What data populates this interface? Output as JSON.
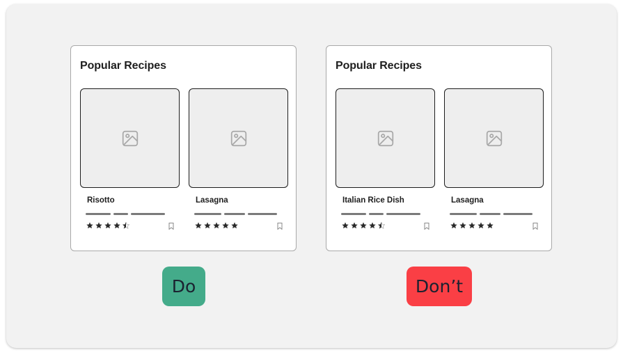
{
  "examples": [
    {
      "card_title": "Popular Recipes",
      "recipes": [
        {
          "name": "Risotto",
          "rating": 4.5,
          "image_icon": "image-placeholder-icon",
          "bookmark_icon": "bookmark-icon"
        },
        {
          "name": "Lasagna",
          "rating": 5,
          "image_icon": "image-placeholder-icon",
          "bookmark_icon": "bookmark-icon"
        }
      ],
      "verdict": {
        "label": "Do",
        "color": "#44ab8a"
      }
    },
    {
      "card_title": "Popular Recipes",
      "recipes": [
        {
          "name": "Italian Rice Dish",
          "rating": 4.5,
          "image_icon": "image-placeholder-icon",
          "bookmark_icon": "bookmark-icon"
        },
        {
          "name": "Lasagna",
          "rating": 5,
          "image_icon": "image-placeholder-icon",
          "bookmark_icon": "bookmark-icon"
        }
      ],
      "verdict": {
        "label": "Don’t",
        "color": "#fa3f45"
      }
    }
  ],
  "colors": {
    "panel_background": "#f2f2f2",
    "star": "#2a2a2a",
    "placeholder_bar": "#7a7a7a"
  }
}
